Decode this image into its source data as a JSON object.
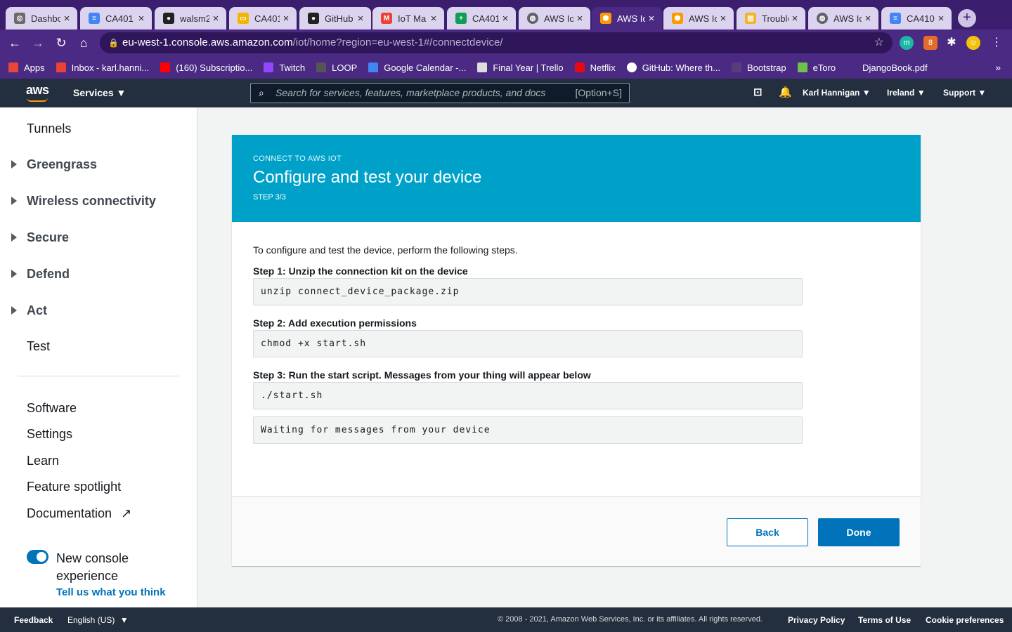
{
  "browser": {
    "tabs": [
      {
        "label": "Dashboard",
        "icon": "dashboard-favicon",
        "color": "#6b6b6b",
        "active": false
      },
      {
        "label": "CA401",
        "icon": "google-docs-favicon",
        "color": "#4285f4",
        "active": false
      },
      {
        "label": "walsm2",
        "icon": "github-favicon",
        "color": "#222222",
        "active": false
      },
      {
        "label": "CA401",
        "icon": "google-slides-favicon",
        "color": "#f4b400",
        "active": false
      },
      {
        "label": "GitHub",
        "icon": "github-favicon",
        "color": "#222222",
        "active": false
      },
      {
        "label": "IoT Ma",
        "icon": "gmail-favicon",
        "color": "#ea4335",
        "active": false
      },
      {
        "label": "CA401",
        "icon": "google-sheets-favicon",
        "color": "#0f9d58",
        "active": false
      },
      {
        "label": "AWS Io",
        "icon": "globe-favicon",
        "color": "#5f6368",
        "active": false
      },
      {
        "label": "AWS Io",
        "icon": "aws-iot-favicon",
        "color": "#ff9900",
        "active": true
      },
      {
        "label": "AWS Io",
        "icon": "aws-iot-favicon",
        "color": "#ff9900",
        "active": false
      },
      {
        "label": "Trouble",
        "icon": "docs-favicon",
        "color": "#f0b429",
        "active": false
      },
      {
        "label": "AWS Io",
        "icon": "globe-favicon",
        "color": "#5f6368",
        "active": false
      },
      {
        "label": "CA410",
        "icon": "google-docs-favicon",
        "color": "#4285f4",
        "active": false
      }
    ],
    "url_host": "eu-west-1.console.aws.amazon.com",
    "url_path": "/iot/home?region=eu-west-1#/connectdevice/",
    "bookmarks": [
      {
        "label": "Apps",
        "icon": "apps-grid-icon",
        "color": "#e8453c"
      },
      {
        "label": "Inbox - karl.hanni...",
        "icon": "gmail-icon",
        "color": "#ea4335"
      },
      {
        "label": "(160) Subscriptio...",
        "icon": "youtube-icon",
        "color": "#ff0000"
      },
      {
        "label": "Twitch",
        "icon": "twitch-icon",
        "color": "#9146ff"
      },
      {
        "label": "LOOP",
        "icon": "loop-icon",
        "color": "#555555"
      },
      {
        "label": "Google Calendar -...",
        "icon": "calendar-icon",
        "color": "#4285f4"
      },
      {
        "label": "Final Year | Trello",
        "icon": "trello-icon",
        "color": "#dddddd"
      },
      {
        "label": "Netflix",
        "icon": "netflix-icon",
        "color": "#e50914"
      },
      {
        "label": "GitHub: Where th...",
        "icon": "github-icon",
        "color": "#ffffff"
      },
      {
        "label": "Bootstrap",
        "icon": "bootstrap-icon",
        "color": "#563d7c"
      },
      {
        "label": "eToro",
        "icon": "etoro-icon",
        "color": "#6cc24a"
      },
      {
        "label": "DjangoBook.pdf",
        "icon": "pdf-icon",
        "color": "#4a2a82"
      }
    ]
  },
  "header": {
    "logo": "aws",
    "services": "Services",
    "search_placeholder": "Search for services, features, marketplace products, and docs",
    "search_shortcut": "[Option+S]",
    "user": "Karl Hannigan",
    "region": "Ireland",
    "support": "Support"
  },
  "sidebar": {
    "top_items": [
      {
        "label": "Tunnels",
        "expandable": false
      },
      {
        "label": "Greengrass",
        "expandable": true
      },
      {
        "label": "Wireless connectivity",
        "expandable": true
      },
      {
        "label": "Secure",
        "expandable": true
      },
      {
        "label": "Defend",
        "expandable": true
      },
      {
        "label": "Act",
        "expandable": true
      },
      {
        "label": "Test",
        "expandable": false
      }
    ],
    "bottom_items": [
      "Software",
      "Settings",
      "Learn",
      "Feature spotlight",
      "Documentation"
    ],
    "toggle_label": "New console experience",
    "feedback_link": "Tell us what you think"
  },
  "main": {
    "kicker": "CONNECT TO AWS IOT",
    "title": "Configure and test your device",
    "step": "STEP 3/3",
    "intro": "To configure and test the device, perform the following steps.",
    "steps": [
      {
        "label": "Step 1: Unzip the connection kit on the device",
        "code": "unzip connect_device_package.zip"
      },
      {
        "label": "Step 2: Add execution permissions",
        "code": "chmod +x start.sh"
      },
      {
        "label": "Step 3: Run the start script. Messages from your thing will appear below",
        "code": "./start.sh"
      }
    ],
    "messages": "Waiting for messages from your device",
    "back": "Back",
    "done": "Done"
  },
  "footer": {
    "feedback": "Feedback",
    "language": "English (US)",
    "copyright": "© 2008 - 2021, Amazon Web Services, Inc. or its affiliates. All rights reserved.",
    "privacy": "Privacy Policy",
    "terms": "Terms of Use",
    "cookies": "Cookie preferences"
  }
}
